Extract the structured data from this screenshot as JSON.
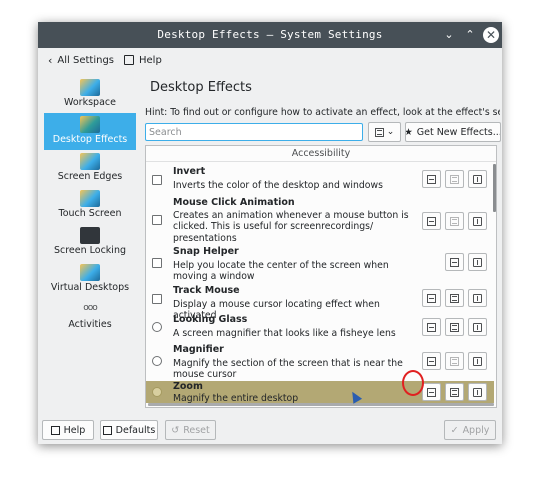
{
  "window": {
    "title": "Desktop Effects — System Settings",
    "controls": {
      "minimize": "⌄",
      "maximize": "⌃",
      "close": "✕"
    }
  },
  "toolbar": {
    "back_label": "All Settings",
    "help_label": "Help"
  },
  "sidebar": {
    "items": [
      {
        "label": "Workspace",
        "icon": "workspace-icon",
        "active": false
      },
      {
        "label": "Desktop Effects",
        "icon": "desktop-effects-icon",
        "active": true
      },
      {
        "label": "Screen Edges",
        "icon": "screen-edges-icon",
        "active": false
      },
      {
        "label": "Touch Screen",
        "icon": "touch-screen-icon",
        "active": false
      },
      {
        "label": "Screen Locking",
        "icon": "screen-locking-icon",
        "active": false
      },
      {
        "label": "Virtual Desktops",
        "icon": "virtual-desktops-icon",
        "active": false
      },
      {
        "label": "Activities",
        "icon": "activities-icon",
        "active": false
      }
    ]
  },
  "main": {
    "title": "Desktop Effects",
    "hint": "Hint: To find out or configure how to activate an effect, look at the effect's setting",
    "search": {
      "placeholder": "Search",
      "value": ""
    },
    "get_new_label": "Get New Effects..."
  },
  "effects": {
    "group_label": "Accessibility",
    "items": [
      {
        "name": "Invert",
        "description": "Inverts the color of the desktop and windows",
        "control": "checkbox"
      },
      {
        "name": "Mouse Click Animation",
        "description": "Creates an animation whenever a mouse button is clicked. This is useful for screenrecordings/ presentations",
        "control": "checkbox"
      },
      {
        "name": "Snap Helper",
        "description": "Help you locate the center of the screen when moving a window",
        "control": "checkbox"
      },
      {
        "name": "Track Mouse",
        "description": "Display a mouse cursor locating effect when activated",
        "control": "checkbox"
      },
      {
        "name": "Looking Glass",
        "description": "A screen magnifier that looks like a fisheye lens",
        "control": "radio"
      },
      {
        "name": "Magnifier",
        "description": "Magnify the section of the screen that is near the mouse cursor",
        "control": "radio"
      },
      {
        "name": "Zoom",
        "description": "Magnify the entire desktop",
        "control": "radio",
        "selected": true
      }
    ]
  },
  "footer": {
    "help_label": "Help",
    "defaults_label": "Defaults",
    "reset_label": "Reset",
    "apply_label": "Apply"
  },
  "colors": {
    "accent": "#3daee9",
    "titlebar": "#475057",
    "selected_row": "#b3a874",
    "highlight_ring": "#e02020"
  }
}
